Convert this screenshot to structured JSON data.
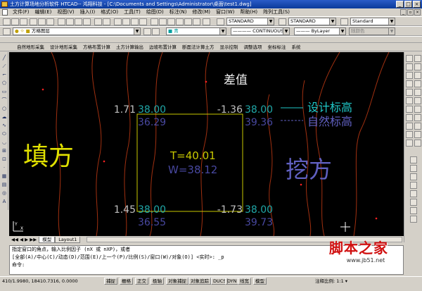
{
  "titlebar": {
    "title": "土方计算场地分析软件 HTCAD-- 鸿翔科技 - [C:\\Documents and Settings\\Administrator\\桌面\\test1.dwg]"
  },
  "menu": [
    "文件(F)",
    "编辑(E)",
    "视图(V)",
    "插入(I)",
    "格式(O)",
    "工具(T)",
    "绘图(D)",
    "标注(N)",
    "修改(M)",
    "窗口(W)",
    "帮助(H)",
    "阵列工具(S)"
  ],
  "toolbar1": {
    "text_style": "STANDARD",
    "dim_style": "STANDARD",
    "table_style": "Standard"
  },
  "toolbar2": {
    "layer": "方格图层",
    "color": "■ 青",
    "linetype": "———— CONTINUOUS",
    "lineweight": "——— ByLayer",
    "plotstyle": "随颜色"
  },
  "plugin_menu": [
    "自然地形采集",
    "设计地形采集",
    "方格布置计算",
    "土方计算输出",
    "边坡布置计算",
    "断面法计算土方",
    "显示控制",
    "调整选项",
    "坐标标注",
    "系统"
  ],
  "drawing": {
    "diff_label": "差值",
    "design_label": "设计标高",
    "natural_label": "自然标高",
    "fill_label": "填方",
    "cut_label": "挖方",
    "center_t": "T=40.01",
    "center_w": "W=38.12",
    "corners": {
      "tl": {
        "diff": "1.71",
        "design": "38.00",
        "natural": "36.29"
      },
      "tr": {
        "diff": "-1.36",
        "design": "38.00",
        "natural": "39.36"
      },
      "bl": {
        "diff": "1.45",
        "design": "38.00",
        "natural": "36.55"
      },
      "br": {
        "diff": "-1.73",
        "design": "38.00",
        "natural": "39.73"
      }
    },
    "watermark_main": "脚本之家",
    "watermark_url": "www.jb51.net"
  },
  "tabs": [
    "模型",
    "Layout1"
  ],
  "command": {
    "line1": "指定窗口的角点，输入比例因子 (nX 或 nXP)，或者",
    "line2": "[全部(A)/中心(C)/动态(D)/范围(E)/上一个(P)/比例(S)/窗口(W)/对象(O)] <实时>: _p",
    "line3": "命令:"
  },
  "status": {
    "coords": "410/1.9980, 18410.7316, 0.0000",
    "buttons": [
      "捕捉",
      "栅格",
      "正交",
      "极轴",
      "对象捕捉",
      "对象追踪",
      "DUCS",
      "DYN",
      "线宽",
      "模型"
    ],
    "annotation": "注释比例: 1:1 ▾"
  },
  "colors": {
    "canvas": "#000000",
    "grid_box": "#c8c800",
    "diff_text": "#c0c0c0",
    "design_text": "#20a8a8",
    "natural_text": "#4848a0",
    "contour": "#a03010",
    "design_label": "#20c8c8",
    "fill_label": "#e0e000",
    "cut_label": "#6060c0"
  }
}
